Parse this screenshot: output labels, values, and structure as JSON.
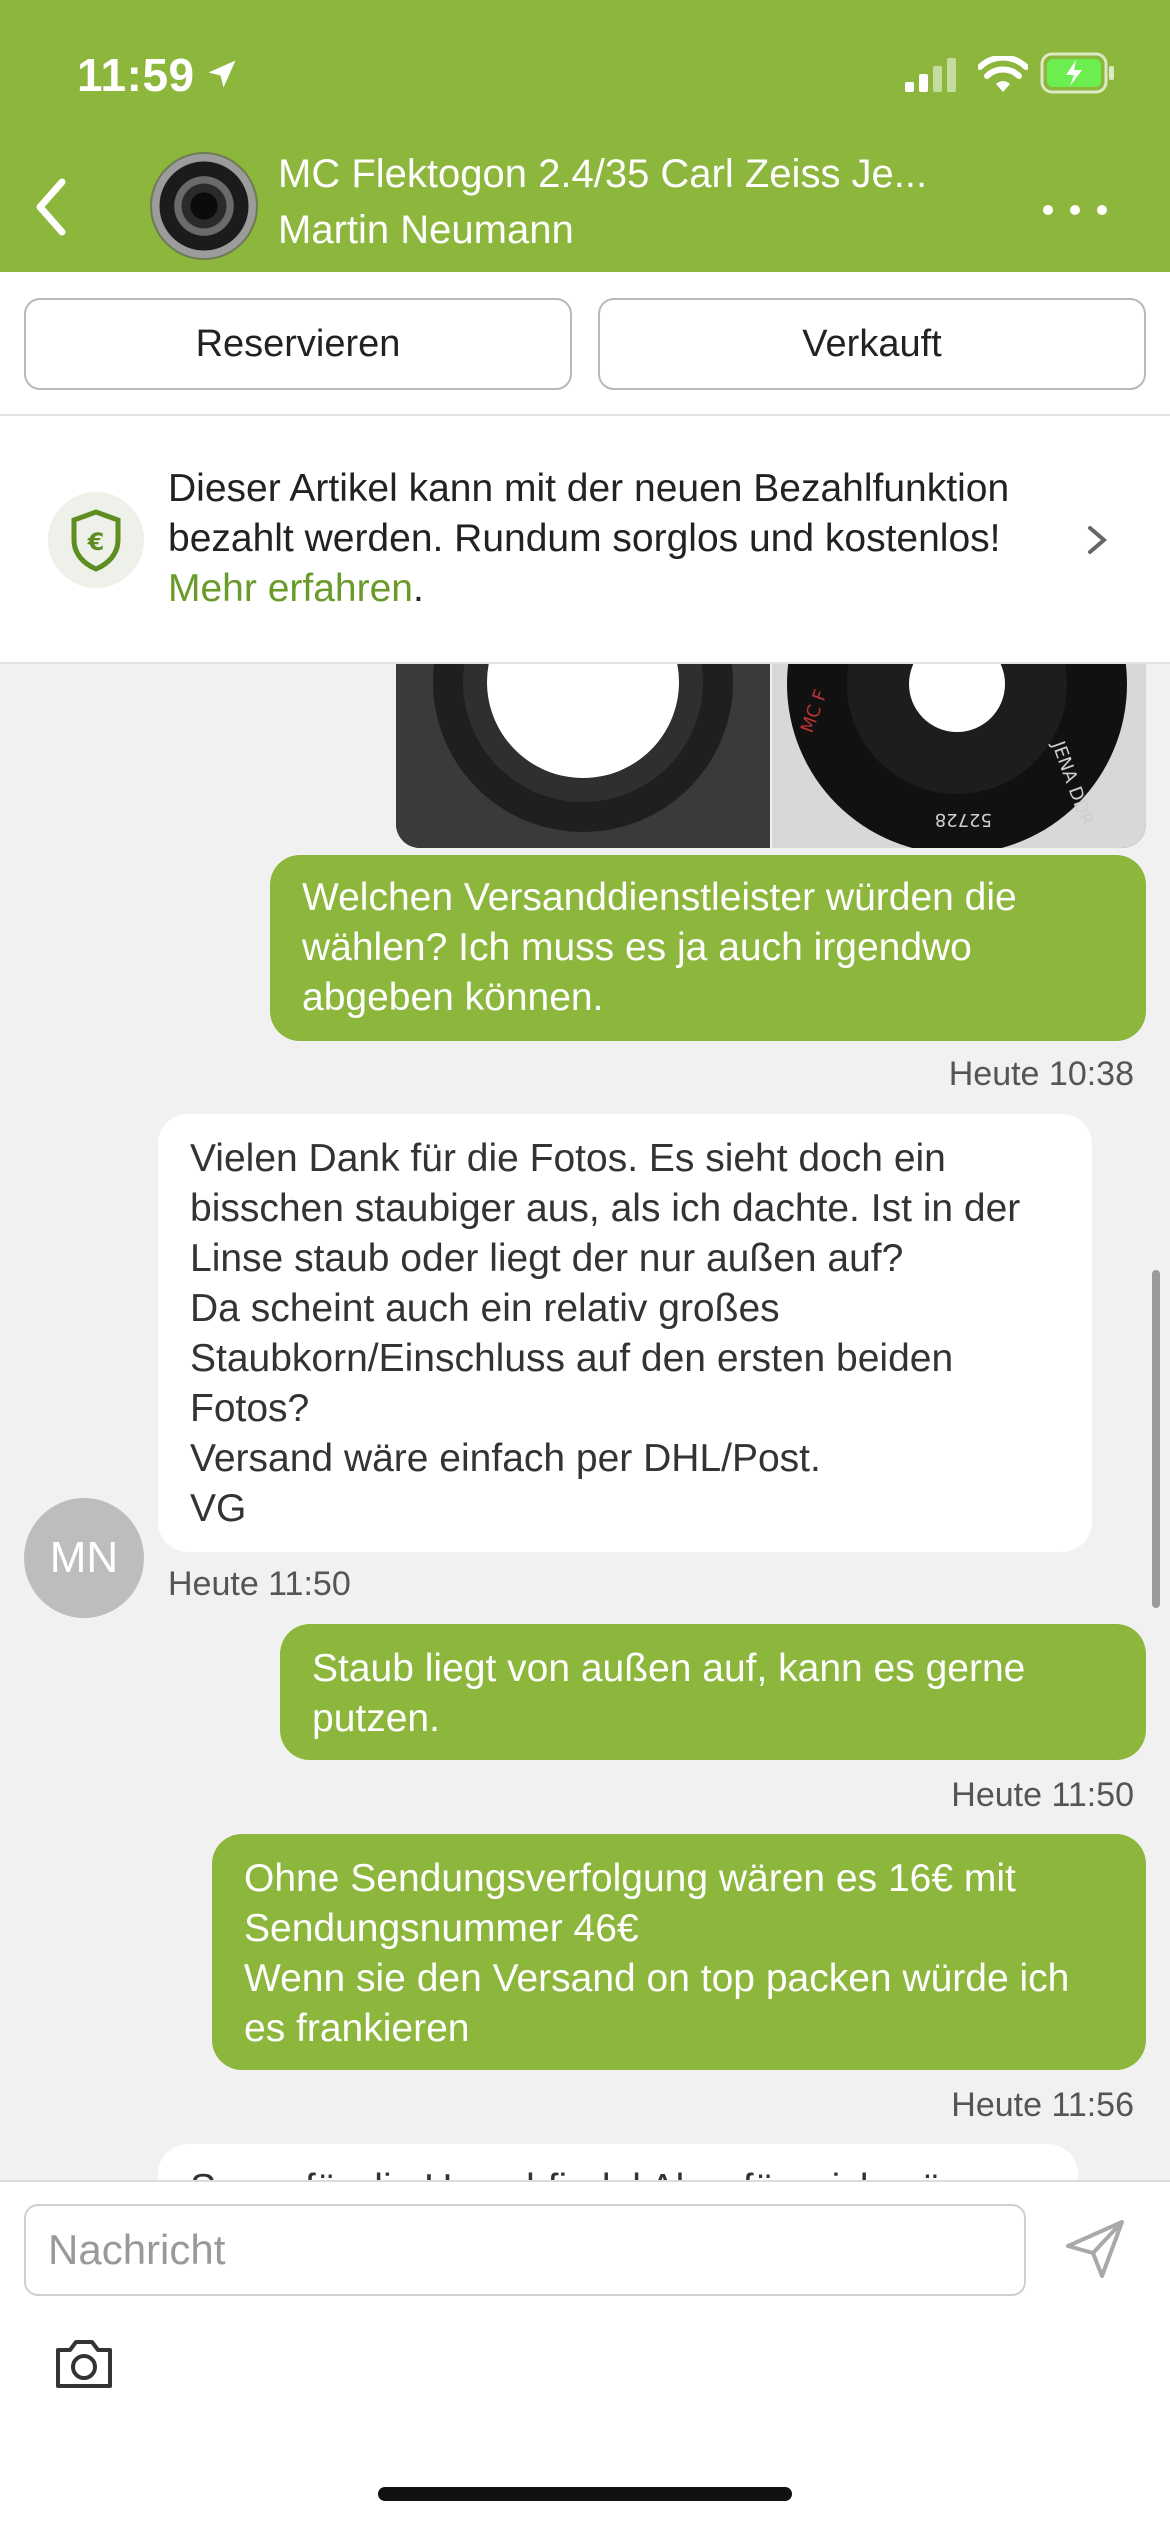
{
  "status_bar": {
    "time": "11:59"
  },
  "header": {
    "title": "MC Flektogon 2.4/35 Carl Zeiss Je...",
    "subtitle": "Martin Neumann"
  },
  "actions": {
    "reserve": "Reservieren",
    "sold": "Verkauft"
  },
  "banner": {
    "text": "Dieser Artikel kann mit der neuen Bezahlfunktion bezahlt werden. Rundum sorglos und kostenlos! ",
    "link": "Mehr erfahren",
    "tail": "."
  },
  "messages": [
    {
      "dir": "out",
      "text": "Welchen Versanddienstleister würden die wählen? Ich muss es ja auch irgendwo abgeben können.",
      "time": "Heute 10:38"
    },
    {
      "dir": "in",
      "text": "Vielen Dank für die Fotos. Es sieht doch ein bisschen staubiger aus, als ich dachte. Ist in der Linse staub oder liegt der nur außen auf?\nDa scheint auch ein relativ großes Staubkorn/Einschluss auf den ersten beiden Fotos?\nVersand wäre einfach per DHL/Post.\nVG",
      "time": "Heute 11:50",
      "avatar": "MN"
    },
    {
      "dir": "out",
      "text": "Staub liegt von außen auf, kann es gerne putzen.",
      "time": "Heute 11:50"
    },
    {
      "dir": "out",
      "text": "Ohne Sendungsverfolgung wären es 16€ mit Sendungsnummer 46€\nWenn sie den Versand on top packen würde ich es frankieren",
      "time": "Heute 11:56"
    }
  ],
  "partial_message": "Super für die Ursachfindel Aber für mich wär",
  "photo_labels": {
    "lens_text_1": "JENA DDR",
    "lens_text_2": "52728",
    "lens_text_3": "MC F"
  },
  "input": {
    "placeholder": "Nachricht"
  },
  "colors": {
    "brand": "#8cb63c",
    "link": "#6a9a2a"
  }
}
